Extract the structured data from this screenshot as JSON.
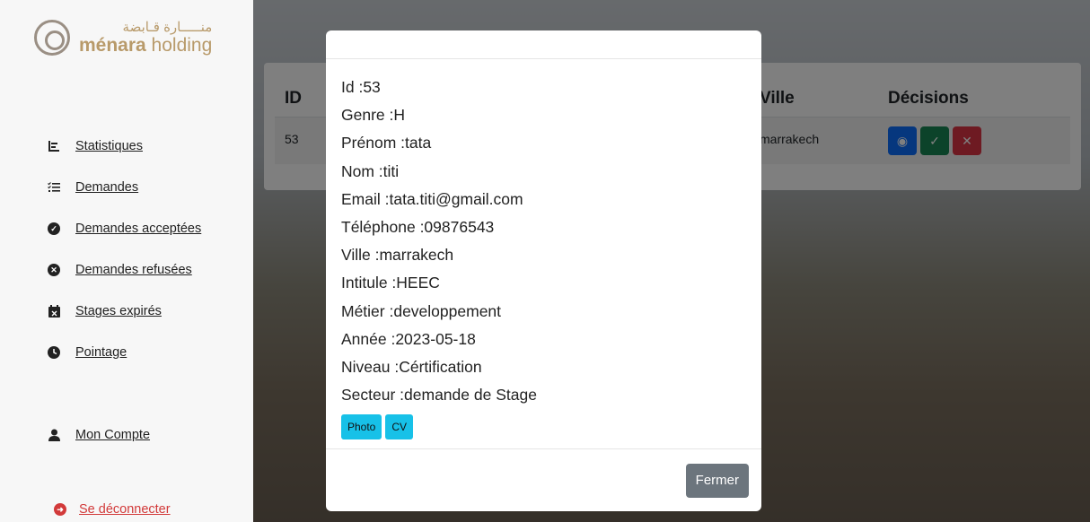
{
  "logo": {
    "arabic": "منـــــارة قـابضة",
    "name_bold": "ménara",
    "name_rest": " holding"
  },
  "sidebar": {
    "items": [
      {
        "label": "Statistiques",
        "icon": "bar-chart-icon"
      },
      {
        "label": "Demandes",
        "icon": "list-check-icon"
      },
      {
        "label": "Demandes acceptées",
        "icon": "check-circle-icon"
      },
      {
        "label": "Demandes refusées",
        "icon": "x-circle-icon"
      },
      {
        "label": "Stages expirés",
        "icon": "calendar-x-icon"
      },
      {
        "label": "Pointage",
        "icon": "clock-icon"
      }
    ],
    "account_label": "Mon Compte",
    "logout_label": "Se déconnecter"
  },
  "table": {
    "headers": {
      "id": "ID",
      "ville": "Ville",
      "decisions": "Décisions"
    },
    "rows": [
      {
        "id": "53",
        "ville": "marrakech"
      }
    ],
    "colors": {
      "view": "#0d6efd",
      "accept": "#198754",
      "reject": "#dc3545"
    }
  },
  "modal": {
    "lines": [
      "Id :53",
      "Genre :H",
      "Prénom :tata",
      "Nom :titi",
      "Email :tata.titi@gmail.com",
      "Téléphone :09876543",
      "Ville :marrakech",
      "Intitule :HEEC",
      "Métier :developpement",
      "Année :2023-05-18",
      "Niveau :Cértification",
      "Secteur :demande de Stage"
    ],
    "photo_label": "Photo",
    "cv_label": "CV",
    "close_label": "Fermer"
  }
}
